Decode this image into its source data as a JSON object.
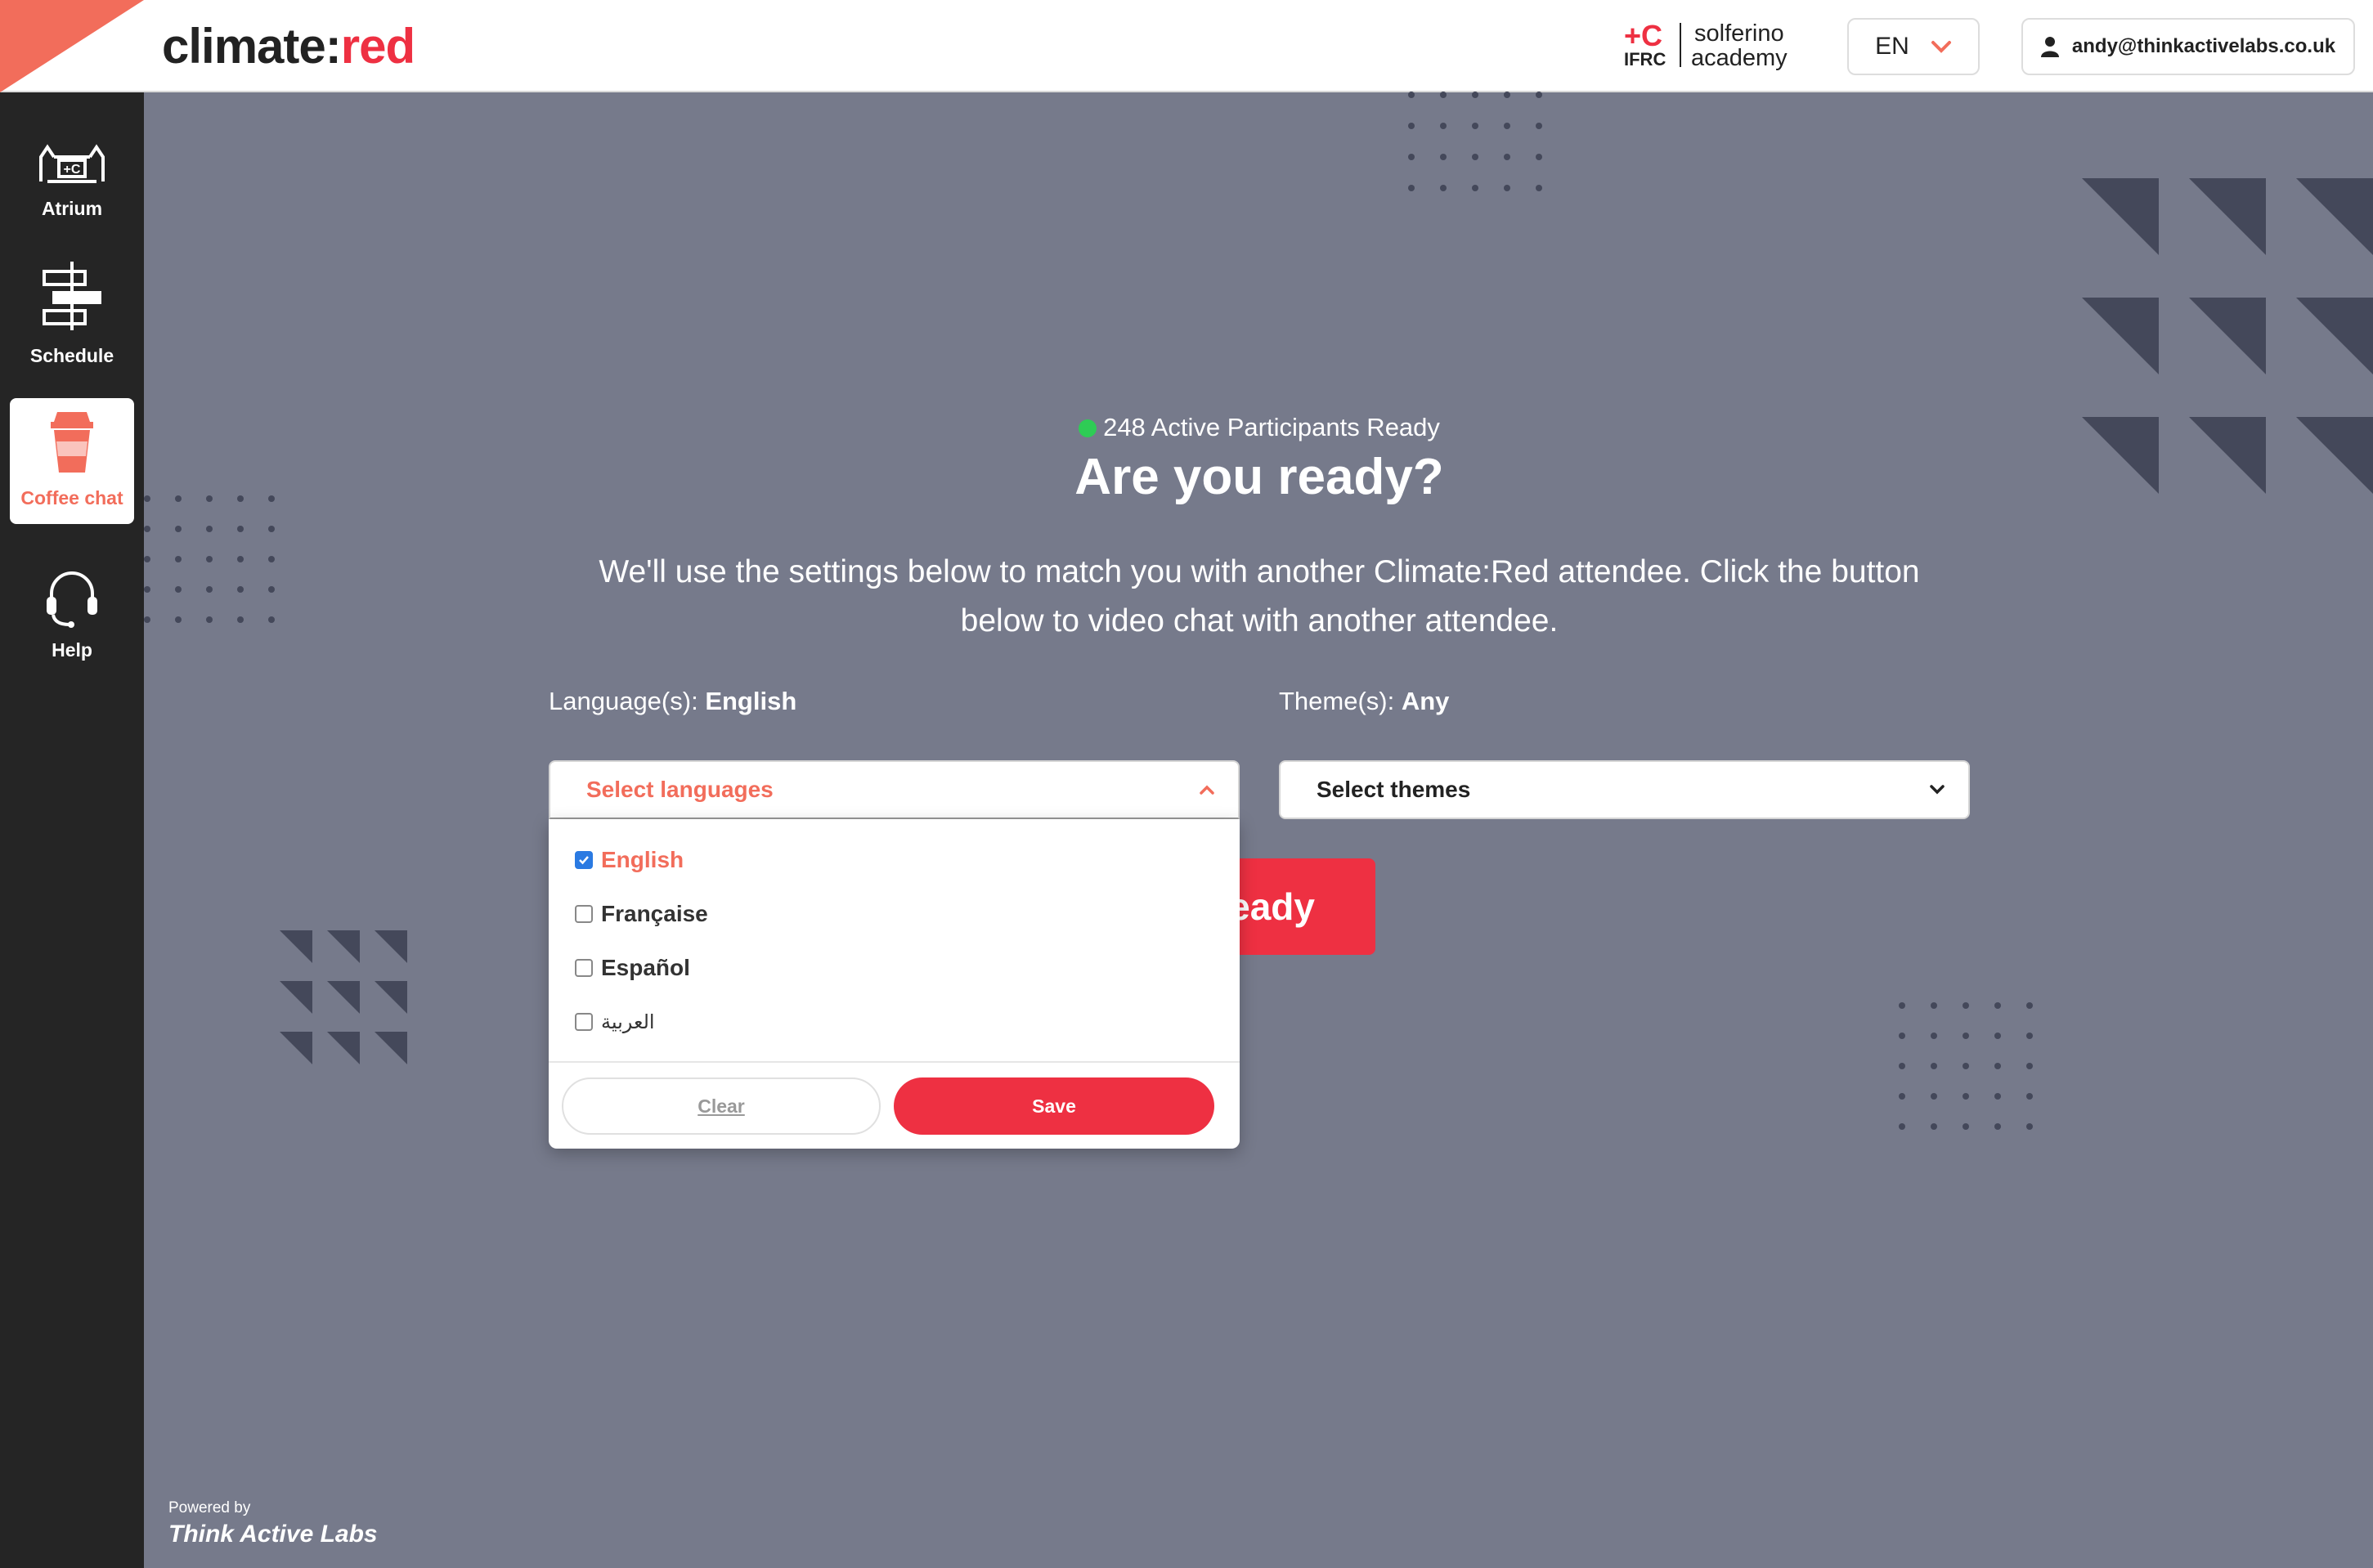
{
  "colors": {
    "brand_red": "#ee3042",
    "coral": "#f26d5b",
    "sidebar_bg": "#252525",
    "main_bg": "#767a8b",
    "online": "#2ecc55"
  },
  "header": {
    "logo_main": "climate:",
    "logo_accent": "red",
    "partner_abbr": "IFRC",
    "partner_line1": "solferino",
    "partner_line2": "academy",
    "language": "EN",
    "user_email": "andy@thinkactivelabs.co.uk"
  },
  "sidebar": {
    "items": [
      {
        "label": "Atrium",
        "icon": "atrium-icon",
        "active": false
      },
      {
        "label": "Schedule",
        "icon": "signpost-icon",
        "active": false
      },
      {
        "label": "Coffee chat",
        "icon": "coffee-cup-icon",
        "active": true
      },
      {
        "label": "Help",
        "icon": "headset-icon",
        "active": false
      }
    ],
    "powered_by": "Powered by",
    "powered_brand": "Think Active Labs"
  },
  "main": {
    "status": "248 Active Participants Ready",
    "title": "Are you ready?",
    "description": "We'll use the settings below to match you with another Climate:Red attendee. Click the button below to video chat with another attendee.",
    "language_label": "Language(s): ",
    "language_value": "English",
    "theme_label": "Theme(s): ",
    "theme_value": "Any",
    "language_select_placeholder": "Select languages",
    "theme_select_placeholder": "Select themes",
    "ready_button_visible": "eady",
    "language_options": [
      {
        "label": "English",
        "checked": true
      },
      {
        "label": "Française",
        "checked": false
      },
      {
        "label": "Español",
        "checked": false
      },
      {
        "label": "العربية",
        "checked": false
      }
    ],
    "clear_label": "Clear",
    "save_label": "Save"
  }
}
